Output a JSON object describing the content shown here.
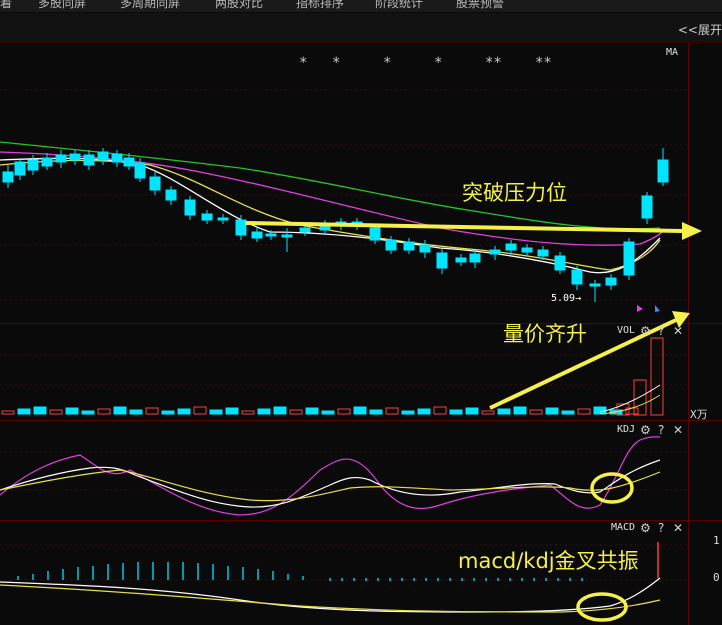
{
  "menu": {
    "items": [
      "着",
      "多股同屏",
      "多周期同屏",
      "两股对比",
      "指标排序",
      "阶段统计",
      "股票预警"
    ]
  },
  "toolbar": {
    "expand_label": "<<展开"
  },
  "main_chart": {
    "indicator_label": "MA",
    "low_price_label": "5.09→",
    "stars": [
      "*",
      "*",
      "*",
      "*",
      "**",
      "**"
    ]
  },
  "volume_panel": {
    "label": "VOL",
    "unit_label": "X万"
  },
  "kdj_panel": {
    "label": "KDJ"
  },
  "macd_panel": {
    "label": "MACD",
    "right_label_1": "1",
    "right_label_2": "0"
  },
  "annotations": {
    "breakout": "突破压力位",
    "volume_price": "量价齐升",
    "golden_cross": "macd/kdj金叉共振"
  },
  "colors": {
    "background": "#0a0a0a",
    "up_candle": "#ff3c3c",
    "down_candle": "#00e5ff",
    "annotation": "#f5f04a",
    "ma_green": "#22c722",
    "ma_magenta": "#e040e0",
    "ma_yellow": "#e8e04a",
    "ma_white": "#ffffff"
  },
  "icons": {
    "settings": "gear-icon",
    "help": "question-icon",
    "close": "close-icon"
  }
}
